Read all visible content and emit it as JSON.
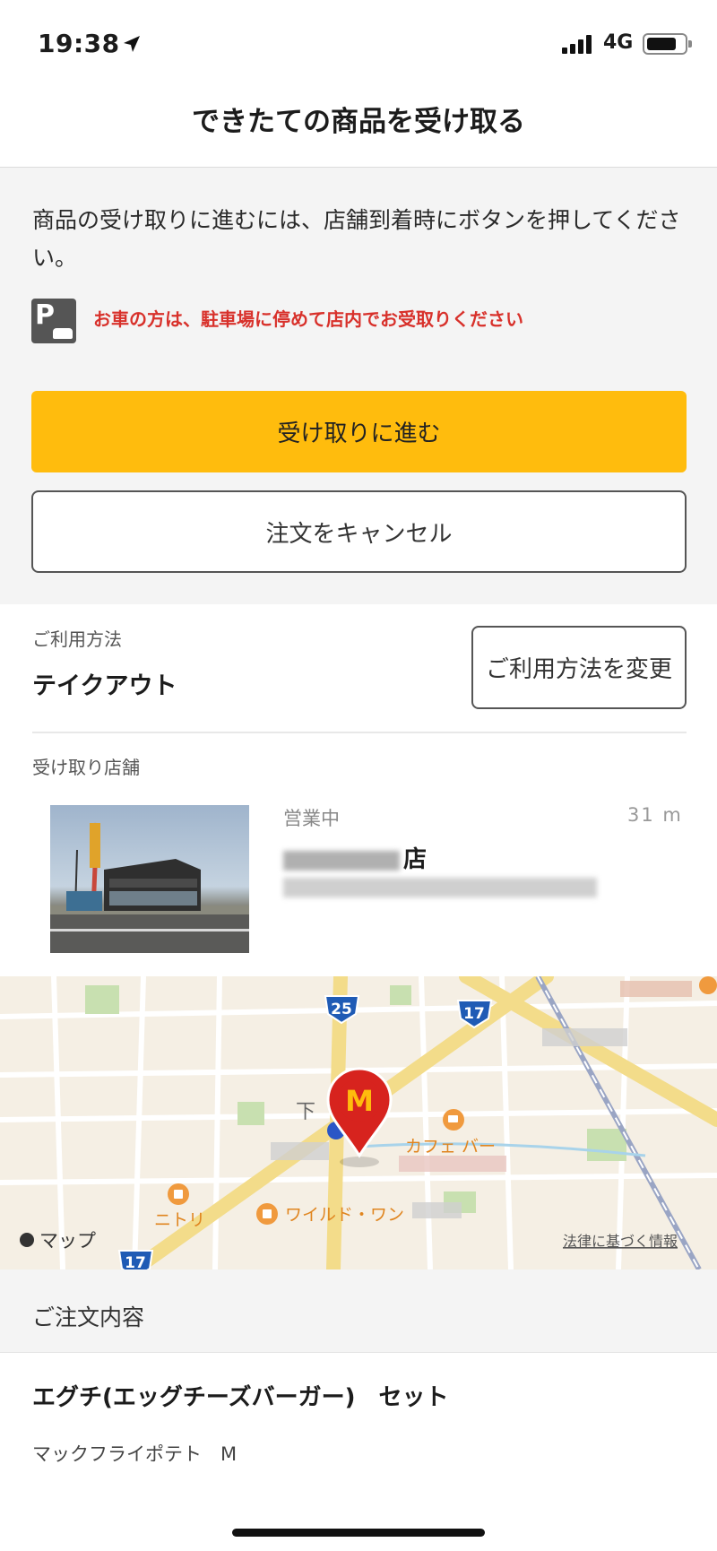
{
  "status_bar": {
    "time": "19:38",
    "network": "4G"
  },
  "header": {
    "title": "できたての商品を受け取る"
  },
  "pickup": {
    "instruction": "商品の受け取りに進むには、店舗到着時にボタンを押してください。",
    "parking_note": "お車の方は、駐車場に停めて店内でお受取りください",
    "proceed_button": "受け取りに進む",
    "cancel_button": "注文をキャンセル"
  },
  "usage": {
    "label": "ご利用方法",
    "value": "テイクアウト",
    "change_button": "ご利用方法を変更"
  },
  "store": {
    "label": "受け取り店舗",
    "status": "営業中",
    "distance": "31 m",
    "name_suffix": "店"
  },
  "map": {
    "route_25": "25",
    "route_17_top": "17",
    "route_17_bottom": "17",
    "station_partial": "下",
    "place_cafe": "カフェ バー",
    "place_nitori": "ニトリ",
    "place_wild": "ワイルド・ワン",
    "apple_maps": "マップ",
    "legal": "法律に基づく情報",
    "pin_logo": "M"
  },
  "order": {
    "header": "ご注文内容",
    "item": "エグチ(エッグチーズバーガー)　セット",
    "side": "マックフライポテト　M"
  },
  "colors": {
    "accent": "#ffbc0d",
    "alert": "#d8312b",
    "pin": "#d7231e"
  },
  "redacted": {
    "store_name_prefix": "[blurred]",
    "store_address": "[blurred]",
    "map_labels": "[blurred]"
  }
}
